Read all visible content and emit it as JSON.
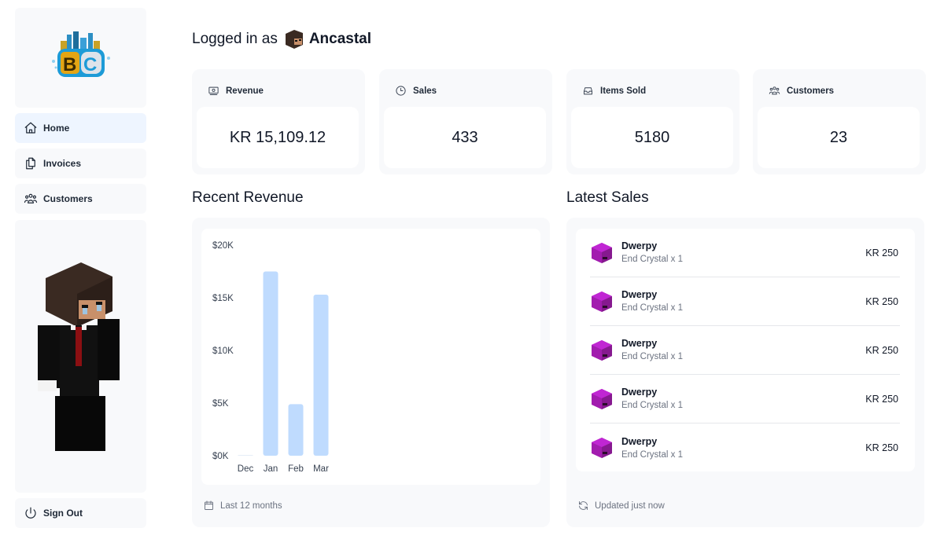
{
  "app": {
    "logo_text": "BC"
  },
  "sidebar": {
    "items": [
      {
        "label": "Home",
        "icon": "home-icon",
        "active": true
      },
      {
        "label": "Invoices",
        "icon": "documents-icon",
        "active": false
      },
      {
        "label": "Customers",
        "icon": "users-icon",
        "active": false
      }
    ],
    "sign_out_label": "Sign Out",
    "sign_out_icon": "power-icon"
  },
  "header": {
    "prefix": "Logged in as",
    "username": "Ancastal"
  },
  "stats": [
    {
      "label": "Revenue",
      "icon": "banknote-icon",
      "value": "KR 15,109.12"
    },
    {
      "label": "Sales",
      "icon": "clock-icon",
      "value": "433"
    },
    {
      "label": "Items Sold",
      "icon": "inbox-icon",
      "value": "5180"
    },
    {
      "label": "Customers",
      "icon": "users-icon",
      "value": "23"
    }
  ],
  "recent_revenue": {
    "title": "Recent Revenue",
    "footer": "Last 12 months",
    "footer_icon": "calendar-icon"
  },
  "latest_sales": {
    "title": "Latest Sales",
    "footer": "Updated just now",
    "footer_icon": "refresh-icon",
    "items": [
      {
        "name": "Dwerpy",
        "item": "End Crystal x 1",
        "amount": "KR 250"
      },
      {
        "name": "Dwerpy",
        "item": "End Crystal x 1",
        "amount": "KR 250"
      },
      {
        "name": "Dwerpy",
        "item": "End Crystal x 1",
        "amount": "KR 250"
      },
      {
        "name": "Dwerpy",
        "item": "End Crystal x 1",
        "amount": "KR 250"
      },
      {
        "name": "Dwerpy",
        "item": "End Crystal x 1",
        "amount": "KR 250"
      }
    ]
  },
  "colors": {
    "bar": "#bfdbfe",
    "card_bg": "#f8f9fb",
    "active_nav": "#eef5ff",
    "cube": "#a21caf"
  },
  "chart_data": {
    "type": "bar",
    "title": "Recent Revenue",
    "categories": [
      "Dec",
      "Jan",
      "Feb",
      "Mar"
    ],
    "values": [
      0,
      17500,
      4900,
      15300
    ],
    "yticks": [
      0,
      5000,
      10000,
      15000,
      20000
    ],
    "ytick_labels": [
      "$0K",
      "$5K",
      "$10K",
      "$15K",
      "$20K"
    ],
    "ylim": [
      0,
      20000
    ],
    "xlabel": "",
    "ylabel": "",
    "grid": false,
    "legend": "none"
  }
}
